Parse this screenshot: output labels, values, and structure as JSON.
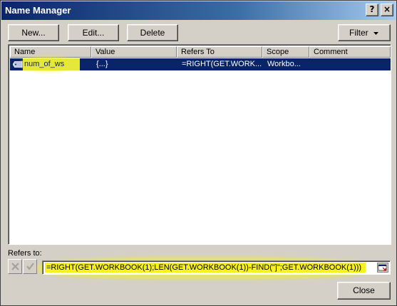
{
  "window": {
    "title": "Name Manager",
    "help_label": "?",
    "close_label": "×"
  },
  "toolbar": {
    "new_label": "New...",
    "edit_label": "Edit...",
    "delete_label": "Delete",
    "filter_label": "Filter"
  },
  "list": {
    "columns": [
      "Name",
      "Value",
      "Refers To",
      "Scope",
      "Comment"
    ],
    "rows": [
      {
        "name": "num_of_ws",
        "value": "{...}",
        "refers_to": "=RIGHT(GET.WORK...",
        "scope": "Workbo...",
        "comment": ""
      }
    ],
    "selected_row": 0
  },
  "refers_to": {
    "label": "Refers to:",
    "value": "=RIGHT(GET.WORKBOOK(1);LEN(GET.WORKBOOK(1))-FIND(\"]\";GET.WORKBOOK(1)))"
  },
  "footer": {
    "close_label": "Close"
  },
  "colors": {
    "title_bar": "#0a246a",
    "selection": "#0a246a",
    "highlight_yellow": "#f6f21e",
    "dialog_face": "#d4d0c8"
  },
  "icons": {
    "name_tag": "name-tag-icon",
    "cancel": "cancel-x-icon",
    "enter": "enter-check-icon",
    "collapse": "collapse-dialog-icon",
    "filter_dropdown": "chevron-down-icon"
  }
}
